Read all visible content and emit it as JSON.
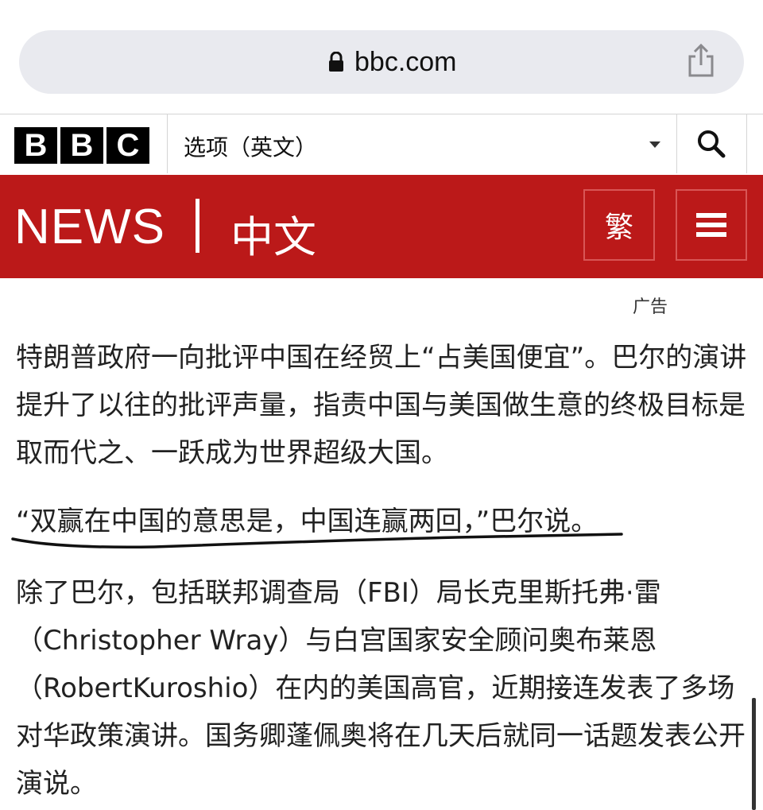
{
  "browser": {
    "url": "bbc.com"
  },
  "bbc_bar": {
    "logo_letters": [
      "B",
      "B",
      "C"
    ],
    "language_select": "选项（英文）"
  },
  "news_bar": {
    "title": "NEWS",
    "section": "中文",
    "traditional_button": "繁"
  },
  "ad_label": "广告",
  "article": {
    "paragraphs": [
      "特朗普政府一向批评中国在经贸上“占美国便宜”。巴尔的演讲提升了以往的批评声量，指责中国与美国做生意的终极目标是取而代之、一跃成为世界超级大国。",
      "“双赢在中国的意思是，中国连赢两回，”巴尔说。",
      "除了巴尔，包括联邦调查局（FBI）局长克里斯托弗·雷（Christopher Wray）与白宫国家安全顾问奥布莱恩（RobertKuroshio）在内的美国高官，近期接连发表了多场对华政策演讲。国务卿蓬佩奥将在几天后就同一话题发表公开演说。"
    ]
  },
  "colors": {
    "news_red": "#bb1919",
    "url_bar_bg": "#e9eaef"
  },
  "icons": [
    "lock-icon",
    "share-icon",
    "caret-down-icon",
    "search-icon",
    "hamburger-menu-icon"
  ]
}
